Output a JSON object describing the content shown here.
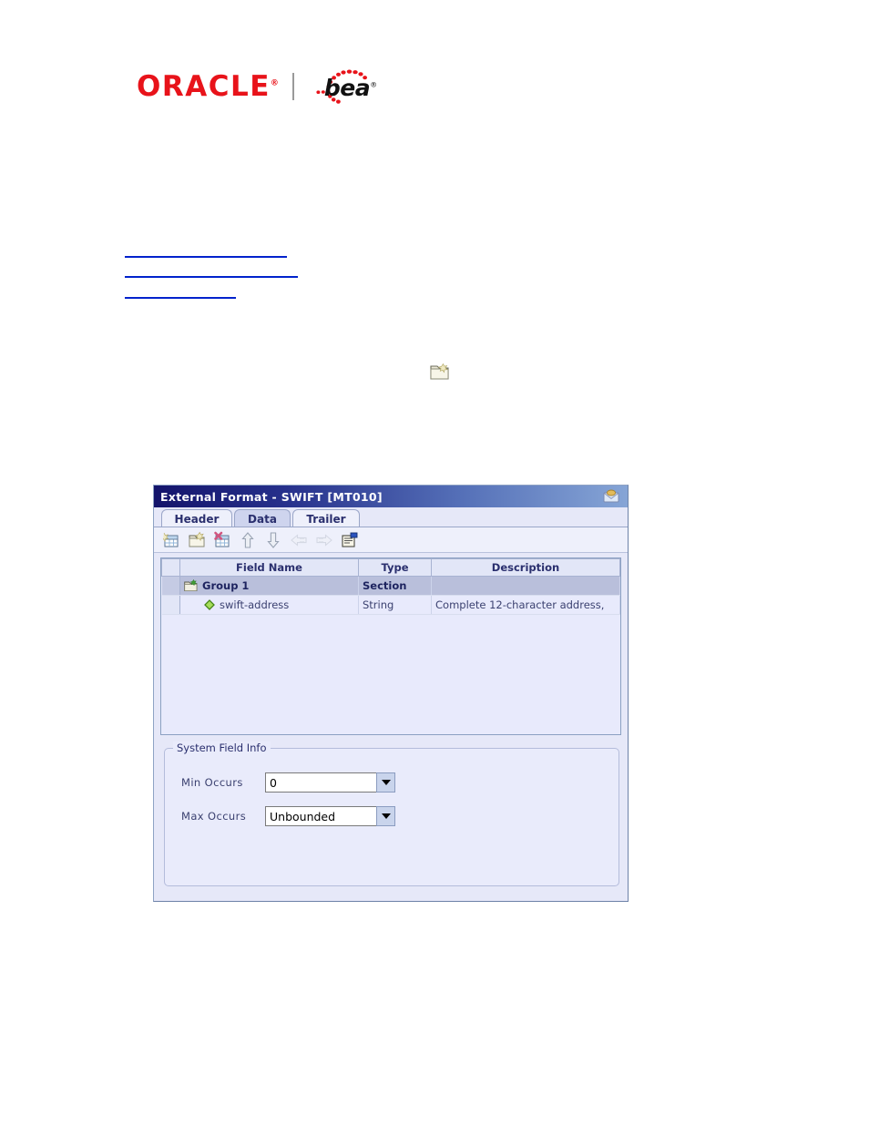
{
  "document": {
    "logo": {
      "oracle_text": "ORACLE",
      "oracle_tm": "®",
      "divider": "|",
      "bea_text": "bea",
      "bea_tm": "®"
    },
    "links": [
      {
        "label": "",
        "name": "doc-link-1"
      },
      {
        "label": "",
        "name": "doc-link-2"
      },
      {
        "label": "",
        "name": "doc-link-3"
      }
    ],
    "inline_icon": "new-group-folder-icon"
  },
  "dialog": {
    "title": "External Format - SWIFT [MT010]",
    "title_icon": "envelope-icon",
    "colors": {
      "titlebar_start": "#14146b",
      "titlebar_end": "#86a5d6",
      "panel_bg": "#e6e8f8",
      "grid_bg": "#e8eafc",
      "header_bg": "#e2e6f7",
      "selection_bg": "#b9bfdb",
      "text_navy": "#2a2f6e",
      "link_blue": "#0022cc",
      "oracle_red": "#e8131a"
    },
    "tabs": [
      {
        "label": "Header",
        "selected": false,
        "name": "tab-header"
      },
      {
        "label": "Data",
        "selected": true,
        "name": "tab-data"
      },
      {
        "label": "Trailer",
        "selected": false,
        "name": "tab-trailer"
      }
    ],
    "toolbar": [
      {
        "name": "new-field-icon",
        "title": "New Field",
        "disabled": false
      },
      {
        "name": "new-group-icon",
        "title": "New Group",
        "disabled": false
      },
      {
        "name": "delete-field-icon",
        "title": "Delete Field",
        "disabled": false
      },
      {
        "name": "move-up-icon",
        "title": "Move Up",
        "disabled": false
      },
      {
        "name": "move-down-icon",
        "title": "Move Down",
        "disabled": false
      },
      {
        "name": "promote-left-icon",
        "title": "Promote",
        "disabled": true
      },
      {
        "name": "demote-right-icon",
        "title": "Demote",
        "disabled": true
      },
      {
        "name": "properties-icon",
        "title": "Properties",
        "disabled": false
      }
    ],
    "grid": {
      "columns": [
        "",
        "Field Name",
        "Type",
        "Description"
      ],
      "rows": [
        {
          "field_name": "Group 1",
          "type": "Section",
          "description": "",
          "icon": "folder-new-icon",
          "indent": 0,
          "selected": true
        },
        {
          "field_name": "swift-address",
          "type": "String",
          "description": "Complete 12-character address,",
          "icon": "green-diamond-icon",
          "indent": 1,
          "selected": false
        }
      ]
    },
    "system_field_info": {
      "legend": "System Field Info",
      "min_occurs": {
        "label": "Min Occurs",
        "value": "0"
      },
      "max_occurs": {
        "label": "Max Occurs",
        "value": "Unbounded"
      }
    }
  }
}
